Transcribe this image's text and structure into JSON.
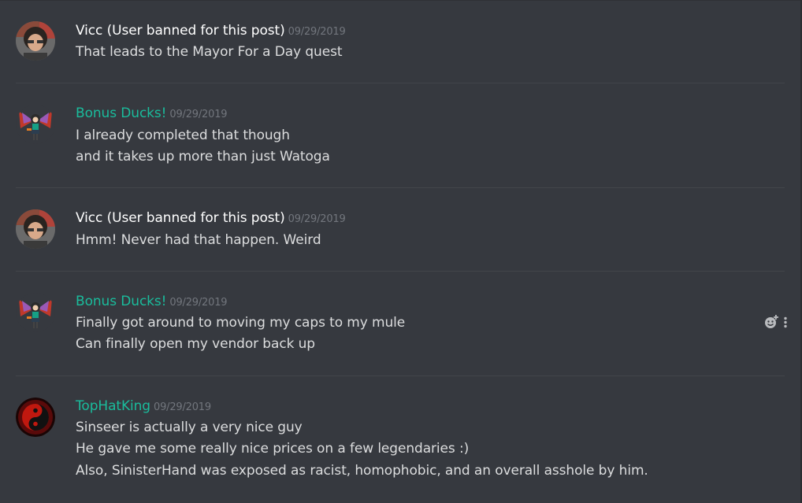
{
  "colors": {
    "background": "#36393f",
    "divider": "#42454a",
    "message_text": "#dcddde",
    "timestamp": "#72767d",
    "username_default": "#ffffff",
    "username_teal": "#1abc9c"
  },
  "messages": [
    {
      "author": "Vicc (User banned for this post)",
      "author_color": "#ffffff",
      "timestamp": "09/29/2019",
      "avatar": "vicc-avatar",
      "lines": [
        "That leads to the Mayor For a Day quest"
      ]
    },
    {
      "author": "Bonus Ducks!",
      "author_color": "#1abc9c",
      "timestamp": "09/29/2019",
      "avatar": "bonus-ducks-avatar",
      "lines": [
        "I already completed that though",
        "and it takes up more than just Watoga"
      ]
    },
    {
      "author": "Vicc (User banned for this post)",
      "author_color": "#ffffff",
      "timestamp": "09/29/2019",
      "avatar": "vicc-avatar",
      "lines": [
        "Hmm! Never had that happen. Weird"
      ]
    },
    {
      "author": "Bonus Ducks!",
      "author_color": "#1abc9c",
      "timestamp": "09/29/2019",
      "avatar": "bonus-ducks-avatar",
      "lines": [
        "Finally got around to moving my caps to my mule",
        "Can finally open my vendor back up"
      ]
    },
    {
      "author": "TopHatKing",
      "author_color": "#1abc9c",
      "timestamp": "09/29/2019",
      "avatar": "tophatking-avatar",
      "lines": [
        "Sinseer is actually a very nice guy",
        "He gave me some really nice prices on a few legendaries :)",
        "Also, SinisterHand was exposed as racist, homophobic, and an overall asshole by him."
      ]
    }
  ],
  "hover_actions": {
    "reaction_icon": "add-reaction-icon",
    "more_icon": "more-options-icon"
  }
}
